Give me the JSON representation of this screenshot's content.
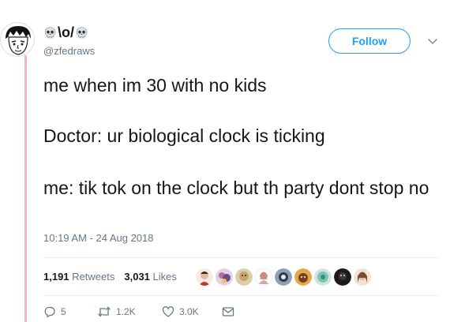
{
  "tweet": {
    "display_name": "\\o/",
    "handle": "@zfedraws",
    "follow_label": "Follow",
    "paragraphs": [
      "me when im 30 with no kids",
      "Doctor: ur biological clock is ticking",
      "me: tik tok on the clock but th party dont stop no"
    ],
    "timestamp": "10:19 AM - 24 Aug 2018"
  },
  "stats": {
    "retweets_count": "1,191",
    "retweets_label": "Retweets",
    "likes_count": "3,031",
    "likes_label": "Likes"
  },
  "actions": {
    "replies": "5",
    "retweets": "1.2K",
    "likes": "3.0K"
  },
  "colors": {
    "accent": "#1da1f2",
    "thread_line": "#f1b7c2",
    "muted_text": "#657786"
  },
  "icons": [
    "skull-icon",
    "chevron-down-icon",
    "reply-icon",
    "retweet-icon",
    "heart-icon",
    "message-icon"
  ]
}
